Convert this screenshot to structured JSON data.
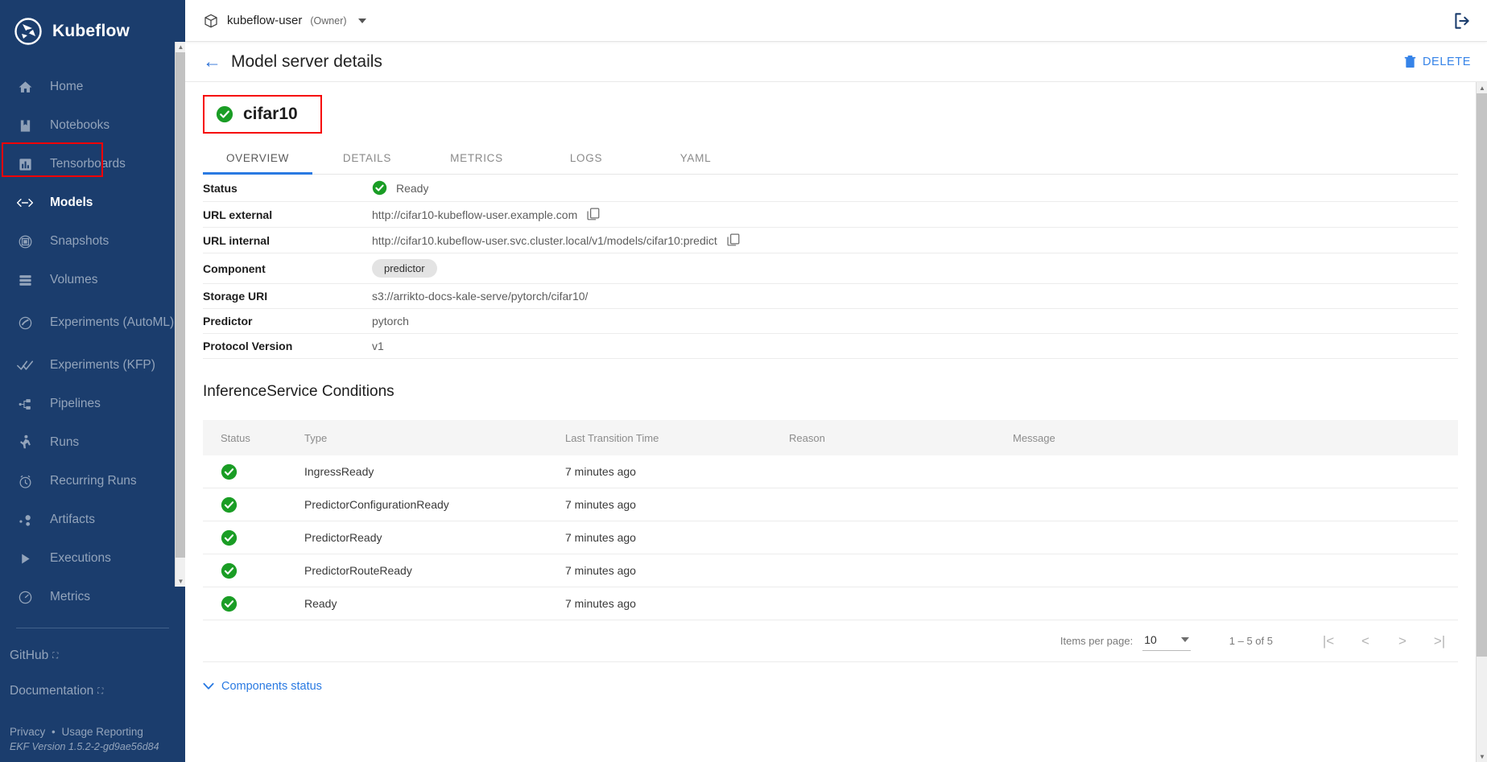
{
  "sidebar": {
    "brand": "Kubeflow",
    "items": [
      {
        "label": "Home",
        "icon": "home-icon",
        "active": false
      },
      {
        "label": "Notebooks",
        "icon": "notebook-icon",
        "active": false
      },
      {
        "label": "Tensorboards",
        "icon": "tensorboard-icon",
        "active": false
      },
      {
        "label": "Models",
        "icon": "models-code-icon",
        "active": true
      },
      {
        "label": "Snapshots",
        "icon": "snapshots-icon",
        "active": false
      },
      {
        "label": "Volumes",
        "icon": "volumes-icon",
        "active": false
      },
      {
        "label": "Experiments (AutoML)",
        "icon": "experiments-automl-icon",
        "active": false
      },
      {
        "label": "Experiments (KFP)",
        "icon": "experiments-kfp-icon",
        "active": false
      },
      {
        "label": "Pipelines",
        "icon": "pipelines-icon",
        "active": false
      },
      {
        "label": "Runs",
        "icon": "runs-icon",
        "active": false
      },
      {
        "label": "Recurring Runs",
        "icon": "recurring-runs-icon",
        "active": false
      },
      {
        "label": "Artifacts",
        "icon": "artifacts-icon",
        "active": false
      },
      {
        "label": "Executions",
        "icon": "executions-icon",
        "active": false
      },
      {
        "label": "Metrics",
        "icon": "metrics-icon",
        "active": false
      }
    ],
    "external_links": [
      {
        "label": "GitHub"
      },
      {
        "label": "Documentation"
      }
    ],
    "footer": {
      "privacy": "Privacy",
      "separator": "•",
      "usage_reporting": "Usage Reporting",
      "version": "EKF Version 1.5.2-2-gd9ae56d84"
    }
  },
  "topbar": {
    "namespace": "kubeflow-user",
    "role": "(Owner)",
    "namespace_icon": "package-icon",
    "logout_icon": "logout-icon"
  },
  "pagehead": {
    "back_icon": "back-arrow-icon",
    "title": "Model server details",
    "delete_label": "DELETE",
    "delete_icon": "trash-icon"
  },
  "server": {
    "name": "cifar10",
    "status_icon": "check-circle-icon"
  },
  "tabs": [
    {
      "label": "OVERVIEW",
      "active": true
    },
    {
      "label": "DETAILS",
      "active": false
    },
    {
      "label": "METRICS",
      "active": false
    },
    {
      "label": "LOGS",
      "active": false
    },
    {
      "label": "YAML",
      "active": false
    }
  ],
  "details": [
    {
      "key": "Status",
      "value": "Ready",
      "type": "status"
    },
    {
      "key": "URL external",
      "value": "http://cifar10-kubeflow-user.example.com",
      "type": "copyable"
    },
    {
      "key": "URL internal",
      "value": "http://cifar10.kubeflow-user.svc.cluster.local/v1/models/cifar10:predict",
      "type": "copyable"
    },
    {
      "key": "Component",
      "value": "predictor",
      "type": "chip"
    },
    {
      "key": "Storage URI",
      "value": "s3://arrikto-docs-kale-serve/pytorch/cifar10/",
      "type": "text"
    },
    {
      "key": "Predictor",
      "value": "pytorch",
      "type": "text"
    },
    {
      "key": "Protocol Version",
      "value": "v1",
      "type": "text"
    }
  ],
  "conditions": {
    "title": "InferenceService Conditions",
    "columns": [
      "Status",
      "Type",
      "Last Transition Time",
      "Reason",
      "Message"
    ],
    "rows": [
      {
        "status": "ok",
        "type": "IngressReady",
        "time": "7 minutes ago",
        "reason": "",
        "message": ""
      },
      {
        "status": "ok",
        "type": "PredictorConfigurationReady",
        "time": "7 minutes ago",
        "reason": "",
        "message": ""
      },
      {
        "status": "ok",
        "type": "PredictorReady",
        "time": "7 minutes ago",
        "reason": "",
        "message": ""
      },
      {
        "status": "ok",
        "type": "PredictorRouteReady",
        "time": "7 minutes ago",
        "reason": "",
        "message": ""
      },
      {
        "status": "ok",
        "type": "Ready",
        "time": "7 minutes ago",
        "reason": "",
        "message": ""
      }
    ]
  },
  "paginator": {
    "items_per_page_label": "Items per page:",
    "items_per_page_value": "10",
    "range_label": "1 – 5 of 5",
    "first_icon": "first-page-icon",
    "prev_icon": "prev-page-icon",
    "next_icon": "next-page-icon",
    "last_icon": "last-page-icon"
  },
  "components_status": {
    "label": "Components status",
    "icon": "chevron-down-icon"
  },
  "colors": {
    "sidebar_bg": "#1b3d6d",
    "accent_blue": "#2a7ae2",
    "success_green": "#1a9d25",
    "highlight_red": "#f60000"
  }
}
